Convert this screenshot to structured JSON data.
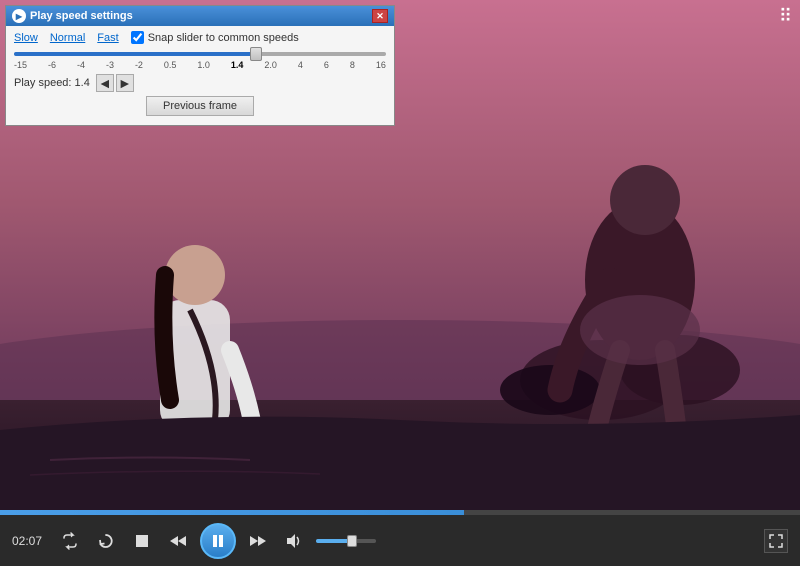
{
  "window": {
    "min_label": "–",
    "max_label": "□",
    "close_label": "✕"
  },
  "speed_popup": {
    "title": "Play speed settings",
    "close_label": "✕",
    "slow_label": "Slow",
    "normal_label": "Normal",
    "fast_label": "Fast",
    "snap_label": "Snap slider to common speeds",
    "slider_value": 65,
    "labels": [
      "-15",
      "-6",
      "-4",
      "-3",
      "-2",
      "0.5",
      "1.0",
      "1.4",
      "2.0",
      "4",
      "6",
      "8",
      "16"
    ],
    "play_speed_label": "Play speed: 1.4",
    "decrease_label": "◄",
    "increase_label": "►",
    "prev_frame_label": "Previous frame"
  },
  "controls": {
    "time": "02:07",
    "repeat_icon": "repeat",
    "refresh_icon": "refresh",
    "stop_icon": "stop",
    "rewind_icon": "rewind",
    "play_icon": "pause",
    "forward_icon": "forward",
    "volume_icon": "volume",
    "fullscreen_icon": "fullscreen",
    "progress_percent": 58,
    "volume_percent": 60
  },
  "dots_icon": "⠿"
}
